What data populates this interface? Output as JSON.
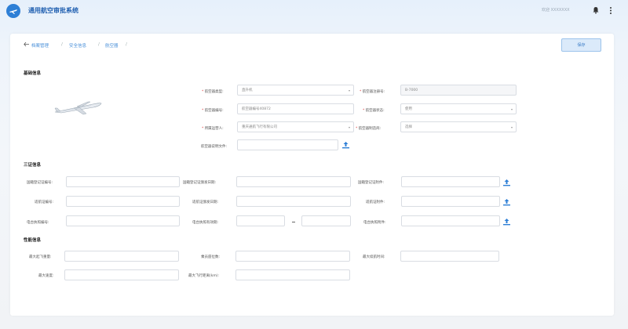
{
  "header": {
    "app_title": "通用航空审批系统",
    "user_text": "欢迎 XXXXXXX"
  },
  "breadcrumb": {
    "items": [
      "档案管理",
      "安全信息",
      "航空器"
    ]
  },
  "toolbar": {
    "save_label": "保存"
  },
  "sections": {
    "basic": "基础信息",
    "three_certs": "三证信息",
    "performance": "性能信息"
  },
  "basic": {
    "type_label": "航空器类型:",
    "type_value": "直升机",
    "reg_label": "航空器注册号:",
    "reg_value": "B-7000",
    "serial_label": "航空器编号:",
    "serial_placeholder": "航空器编号40872",
    "use_label": "航空器状态:",
    "use_value": "使用",
    "owner_label": "所属运营人:",
    "owner_value": "重庆通航飞行有限公司",
    "vendor_label": "航空器制造商:",
    "vendor_value": "选择",
    "file_label": "航空器说明文件:"
  },
  "certs": {
    "nationality_label": "国籍登记证编号:",
    "airworthiness_label": "国籍登记证颁发日期:",
    "nationality_file_label": "国籍登记证附件:",
    "aw_no_label": "适航证编号:",
    "aw_date_label": "适航证颁发日期:",
    "aw_file_label": "适航证附件:",
    "radio_no_label": "电台执照编号:",
    "radio_date_label": "电台执照有效期:",
    "radio_file_label": "电台执照附件:"
  },
  "performance": {
    "fuel_label": "最大起飞重量:",
    "seats_label": "乘员座位数:",
    "hours_label": "最大续航时间:",
    "speed_label": "最大速度:",
    "range_label": "最大飞行距离(km):"
  },
  "colors": {
    "accent": "#2d7fd6",
    "required": "#e04040"
  }
}
